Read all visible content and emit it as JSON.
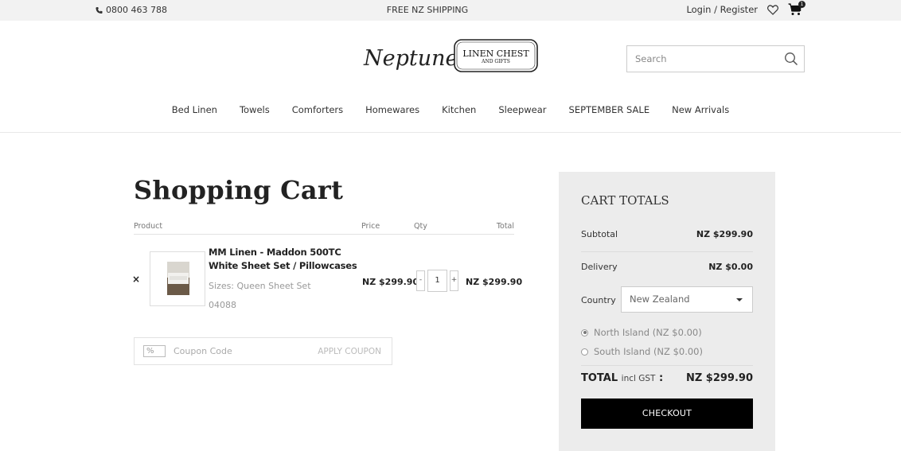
{
  "topbar": {
    "phone": "0800 463 788",
    "shipping": "FREE NZ SHIPPING",
    "login": "Login / Register",
    "cart_count": "1"
  },
  "logo": {
    "script": "Neptune's",
    "line1": "LINEN CHEST",
    "line2": "AND GIFTS"
  },
  "search": {
    "placeholder": "Search"
  },
  "nav": {
    "items": [
      "Bed Linen",
      "Towels",
      "Comforters",
      "Homewares",
      "Kitchen",
      "Sleepwear",
      "SEPTEMBER SALE",
      "New Arrivals"
    ]
  },
  "cart": {
    "title": "Shopping Cart",
    "headers": {
      "product": "Product",
      "price": "Price",
      "qty": "Qty",
      "total": "Total"
    },
    "items": [
      {
        "remove": "×",
        "name": "MM Linen - Maddon 500TC White Sheet Set / Pillowcases",
        "size": "Sizes: Queen Sheet Set",
        "sku": "04088",
        "price": "NZ $299.90",
        "qty": "1",
        "total": "NZ $299.90"
      }
    ],
    "qty_minus": "-",
    "qty_plus": "+"
  },
  "coupon": {
    "icon": "%",
    "placeholder": "Coupon Code",
    "button": "APPLY COUPON"
  },
  "totals": {
    "heading": "CART TOTALS",
    "subtotal_label": "Subtotal",
    "subtotal": "NZ $299.90",
    "delivery_label": "Delivery",
    "delivery": "NZ $0.00",
    "country_label": "Country",
    "country": "New Zealand",
    "options": [
      {
        "label": "North Island (NZ $0.00)",
        "selected": true
      },
      {
        "label": "South Island (NZ $0.00)",
        "selected": false
      }
    ],
    "total_label": "TOTAL",
    "total_suffix": "incl GST",
    "total_colon": ":",
    "total": "NZ $299.90",
    "checkout": "CHECKOUT"
  }
}
